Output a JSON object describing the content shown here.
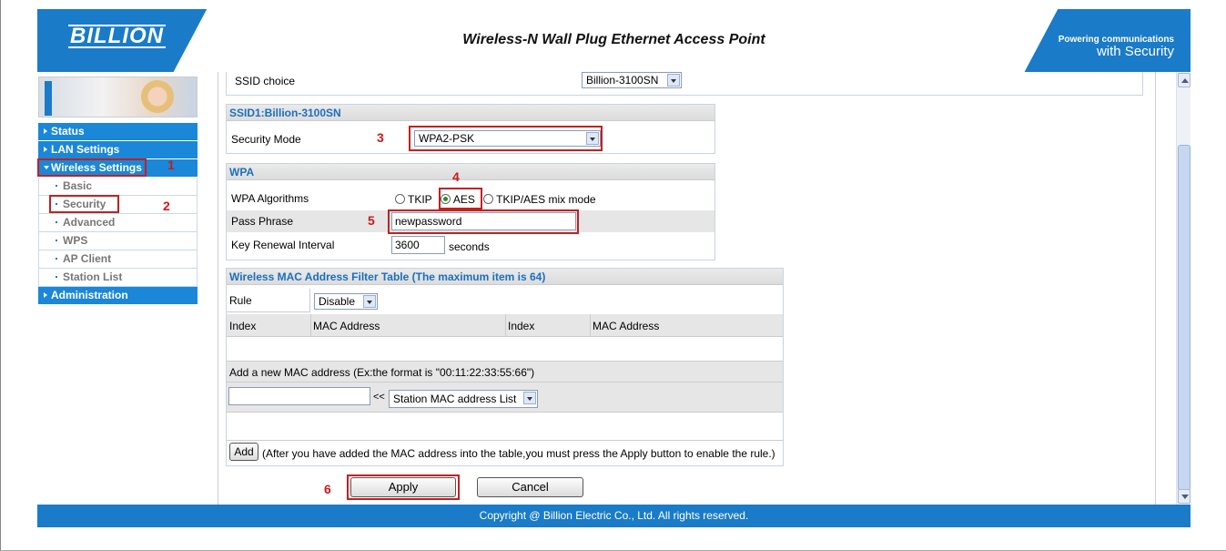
{
  "header": {
    "logo": "BILLION",
    "title": "Wireless-N Wall Plug Ethernet Access Point",
    "tagline_top": "Powering communications",
    "tagline_bottom": "with Security"
  },
  "sidebar": {
    "items": [
      {
        "label": "Status"
      },
      {
        "label": "LAN Settings"
      },
      {
        "label": "Wireless Settings"
      },
      {
        "label": "Basic"
      },
      {
        "label": "Security"
      },
      {
        "label": "Advanced"
      },
      {
        "label": "WPS"
      },
      {
        "label": "AP Client"
      },
      {
        "label": "Station List"
      },
      {
        "label": "Administration"
      }
    ]
  },
  "ssid_choice": {
    "label": "SSID choice",
    "value": "Billion-3100SN"
  },
  "ssid_section": {
    "title": "SSID1:Billion-3100SN",
    "security_mode_label": "Security Mode",
    "security_mode_value": "WPA2-PSK"
  },
  "wpa": {
    "title": "WPA",
    "algorithms_label": "WPA Algorithms",
    "algo_options": [
      "TKIP",
      "AES",
      "TKIP/AES mix mode"
    ],
    "algo_selected": "AES",
    "pass_phrase_label": "Pass Phrase",
    "pass_phrase_value": "newpassword",
    "key_renewal_label": "Key Renewal Interval",
    "key_renewal_value": "3600",
    "key_renewal_unit": "seconds"
  },
  "mac_filter": {
    "title": "Wireless MAC Address Filter Table (The maximum item is 64)",
    "rule_label": "Rule",
    "rule_value": "Disable",
    "columns": [
      "Index",
      "MAC Address",
      "Index",
      "MAC Address"
    ],
    "add_hint": "Add a new MAC address (Ex:the format is \"00:11:22:33:55:66\")",
    "arrow": "<<",
    "station_select": "Station MAC address List",
    "add_button": "Add",
    "add_note": "(After you have added the MAC address into the table,you must press the Apply button to enable the rule.)"
  },
  "buttons": {
    "apply": "Apply",
    "cancel": "Cancel"
  },
  "annotations": {
    "n1": "1",
    "n2": "2",
    "n3": "3",
    "n4": "4",
    "n5": "5",
    "n6": "6"
  },
  "footer": {
    "copyright": "Copyright @ Billion Electric Co., Ltd. All rights reserved."
  },
  "colors": {
    "brand_blue": "#1a7bc8",
    "annotation_red": "#c42020",
    "section_title": "#1a6fc0"
  }
}
